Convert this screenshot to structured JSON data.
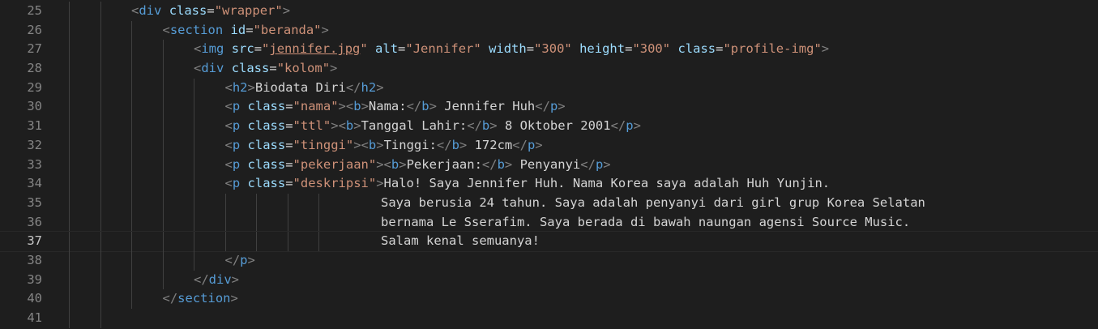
{
  "editor": {
    "lines": [
      {
        "n": "25",
        "indent": 2,
        "tokens": [
          [
            "punc",
            "<"
          ],
          [
            "tag",
            "div"
          ],
          [
            "text",
            " "
          ],
          [
            "attr",
            "class"
          ],
          [
            "text",
            "="
          ],
          [
            "str",
            "\"wrapper\""
          ],
          [
            "punc",
            ">"
          ]
        ]
      },
      {
        "n": "26",
        "indent": 3,
        "tokens": [
          [
            "punc",
            "<"
          ],
          [
            "tag",
            "section"
          ],
          [
            "text",
            " "
          ],
          [
            "attr",
            "id"
          ],
          [
            "text",
            "="
          ],
          [
            "str",
            "\"beranda\""
          ],
          [
            "punc",
            ">"
          ]
        ]
      },
      {
        "n": "27",
        "indent": 4,
        "tokens": [
          [
            "punc",
            "<"
          ],
          [
            "tag",
            "img"
          ],
          [
            "text",
            " "
          ],
          [
            "attr",
            "src"
          ],
          [
            "text",
            "="
          ],
          [
            "str",
            "\""
          ],
          [
            "link",
            "jennifer.jpg"
          ],
          [
            "str",
            "\""
          ],
          [
            "text",
            " "
          ],
          [
            "attr",
            "alt"
          ],
          [
            "text",
            "="
          ],
          [
            "str",
            "\"Jennifer\""
          ],
          [
            "text",
            " "
          ],
          [
            "attr",
            "width"
          ],
          [
            "text",
            "="
          ],
          [
            "str",
            "\"300\""
          ],
          [
            "text",
            " "
          ],
          [
            "attr",
            "height"
          ],
          [
            "text",
            "="
          ],
          [
            "str",
            "\"300\""
          ],
          [
            "text",
            " "
          ],
          [
            "attr",
            "class"
          ],
          [
            "text",
            "="
          ],
          [
            "str",
            "\"profile-img\""
          ],
          [
            "punc",
            ">"
          ]
        ]
      },
      {
        "n": "28",
        "indent": 4,
        "tokens": [
          [
            "punc",
            "<"
          ],
          [
            "tag",
            "div"
          ],
          [
            "text",
            " "
          ],
          [
            "attr",
            "class"
          ],
          [
            "text",
            "="
          ],
          [
            "str",
            "\"kolom\""
          ],
          [
            "punc",
            ">"
          ]
        ]
      },
      {
        "n": "29",
        "indent": 5,
        "tokens": [
          [
            "punc",
            "<"
          ],
          [
            "tag",
            "h2"
          ],
          [
            "punc",
            ">"
          ],
          [
            "text",
            "Biodata Diri"
          ],
          [
            "punc",
            "</"
          ],
          [
            "tag",
            "h2"
          ],
          [
            "punc",
            ">"
          ]
        ]
      },
      {
        "n": "30",
        "indent": 5,
        "tokens": [
          [
            "punc",
            "<"
          ],
          [
            "tag",
            "p"
          ],
          [
            "text",
            " "
          ],
          [
            "attr",
            "class"
          ],
          [
            "text",
            "="
          ],
          [
            "str",
            "\"nama\""
          ],
          [
            "punc",
            ">"
          ],
          [
            "punc",
            "<"
          ],
          [
            "tag",
            "b"
          ],
          [
            "punc",
            ">"
          ],
          [
            "text",
            "Nama:"
          ],
          [
            "punc",
            "</"
          ],
          [
            "tag",
            "b"
          ],
          [
            "punc",
            ">"
          ],
          [
            "text",
            " Jennifer Huh"
          ],
          [
            "punc",
            "</"
          ],
          [
            "tag",
            "p"
          ],
          [
            "punc",
            ">"
          ]
        ]
      },
      {
        "n": "31",
        "indent": 5,
        "tokens": [
          [
            "punc",
            "<"
          ],
          [
            "tag",
            "p"
          ],
          [
            "text",
            " "
          ],
          [
            "attr",
            "class"
          ],
          [
            "text",
            "="
          ],
          [
            "str",
            "\"ttl\""
          ],
          [
            "punc",
            ">"
          ],
          [
            "punc",
            "<"
          ],
          [
            "tag",
            "b"
          ],
          [
            "punc",
            ">"
          ],
          [
            "text",
            "Tanggal Lahir:"
          ],
          [
            "punc",
            "</"
          ],
          [
            "tag",
            "b"
          ],
          [
            "punc",
            ">"
          ],
          [
            "text",
            " 8 Oktober 2001"
          ],
          [
            "punc",
            "</"
          ],
          [
            "tag",
            "p"
          ],
          [
            "punc",
            ">"
          ]
        ]
      },
      {
        "n": "32",
        "indent": 5,
        "tokens": [
          [
            "punc",
            "<"
          ],
          [
            "tag",
            "p"
          ],
          [
            "text",
            " "
          ],
          [
            "attr",
            "class"
          ],
          [
            "text",
            "="
          ],
          [
            "str",
            "\"tinggi\""
          ],
          [
            "punc",
            ">"
          ],
          [
            "punc",
            "<"
          ],
          [
            "tag",
            "b"
          ],
          [
            "punc",
            ">"
          ],
          [
            "text",
            "Tinggi:"
          ],
          [
            "punc",
            "</"
          ],
          [
            "tag",
            "b"
          ],
          [
            "punc",
            ">"
          ],
          [
            "text",
            " 172cm"
          ],
          [
            "punc",
            "</"
          ],
          [
            "tag",
            "p"
          ],
          [
            "punc",
            ">"
          ]
        ]
      },
      {
        "n": "33",
        "indent": 5,
        "tokens": [
          [
            "punc",
            "<"
          ],
          [
            "tag",
            "p"
          ],
          [
            "text",
            " "
          ],
          [
            "attr",
            "class"
          ],
          [
            "text",
            "="
          ],
          [
            "str",
            "\"pekerjaan\""
          ],
          [
            "punc",
            ">"
          ],
          [
            "punc",
            "<"
          ],
          [
            "tag",
            "b"
          ],
          [
            "punc",
            ">"
          ],
          [
            "text",
            "Pekerjaan:"
          ],
          [
            "punc",
            "</"
          ],
          [
            "tag",
            "b"
          ],
          [
            "punc",
            ">"
          ],
          [
            "text",
            " Penyanyi"
          ],
          [
            "punc",
            "</"
          ],
          [
            "tag",
            "p"
          ],
          [
            "punc",
            ">"
          ]
        ]
      },
      {
        "n": "34",
        "indent": 5,
        "tokens": [
          [
            "punc",
            "<"
          ],
          [
            "tag",
            "p"
          ],
          [
            "text",
            " "
          ],
          [
            "attr",
            "class"
          ],
          [
            "text",
            "="
          ],
          [
            "str",
            "\"deskripsi\""
          ],
          [
            "punc",
            ">"
          ],
          [
            "text",
            "Halo! Saya Jennifer Huh. Nama Korea saya adalah Huh Yunjin."
          ]
        ]
      },
      {
        "n": "35",
        "indent": 10,
        "tokens": [
          [
            "text",
            "Saya berusia 24 tahun. Saya adalah penyanyi dari girl grup Korea Selatan"
          ]
        ]
      },
      {
        "n": "36",
        "indent": 10,
        "tokens": [
          [
            "text",
            "bernama Le Sserafim. Saya berada di bawah naungan agensi Source Music."
          ]
        ]
      },
      {
        "n": "37",
        "indent": 10,
        "current": true,
        "tokens": [
          [
            "text",
            "Salam kenal semuanya!"
          ]
        ]
      },
      {
        "n": "38",
        "indent": 5,
        "tokens": [
          [
            "punc",
            "</"
          ],
          [
            "tag",
            "p"
          ],
          [
            "punc",
            ">"
          ]
        ]
      },
      {
        "n": "39",
        "indent": 4,
        "tokens": [
          [
            "punc",
            "</"
          ],
          [
            "tag",
            "div"
          ],
          [
            "punc",
            ">"
          ]
        ]
      },
      {
        "n": "40",
        "indent": 3,
        "tokens": [
          [
            "punc",
            "</"
          ],
          [
            "tag",
            "section"
          ],
          [
            "punc",
            ">"
          ]
        ]
      },
      {
        "n": "41",
        "indent": 2,
        "tokens": []
      }
    ]
  }
}
